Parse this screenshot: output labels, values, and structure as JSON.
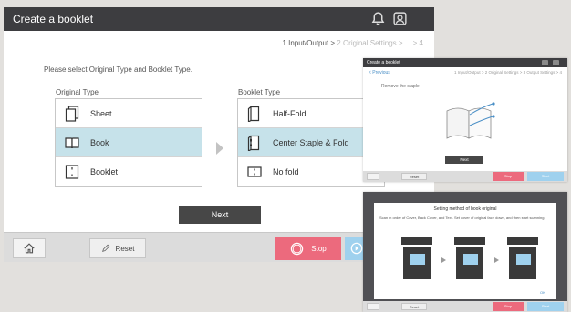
{
  "main": {
    "title": "Create a booklet",
    "steps": {
      "current": "1 Input/Output",
      "separator": " > ",
      "rest": "2 Original Settings > ... > 4"
    },
    "instruction": "Please select Original Type and Booklet Type.",
    "original_type": {
      "label": "Original Type",
      "options": [
        {
          "label": "Sheet",
          "icon": "sheet-icon",
          "selected": false
        },
        {
          "label": "Book",
          "icon": "book-icon",
          "selected": true
        },
        {
          "label": "Booklet",
          "icon": "booklet-icon",
          "selected": false
        }
      ]
    },
    "booklet_type": {
      "label": "Booklet Type",
      "options": [
        {
          "label": "Half-Fold",
          "icon": "half-fold-icon",
          "selected": false
        },
        {
          "label": "Center Staple & Fold",
          "icon": "center-staple-fold-icon",
          "selected": true
        },
        {
          "label": "No fold",
          "icon": "no-fold-icon",
          "selected": false
        }
      ]
    },
    "next_label": "Next",
    "bottom": {
      "reset_label": "Reset",
      "stop_label": "Stop"
    }
  },
  "thumb1": {
    "title": "Create a booklet",
    "previous_label": "< Previous",
    "steps": "1 Input/Output > 2 Original Settings > 3 Output Settings > 4",
    "instruction": "Remove the staple.",
    "next_label": "Next",
    "reset_label": "Reset",
    "stop_label": "Stop",
    "start_label": "Start"
  },
  "thumb2": {
    "dialog_title": "Setting method of book original",
    "dialog_text": "Scan in order of Cover, Back Cover, and Text. Set cover of original face down, and then start scanning.",
    "ok_label": "OK",
    "reset_label": "Reset",
    "stop_label": "Stop",
    "start_label": "Start"
  },
  "colors": {
    "title_bar": "#3d3d40",
    "selected_row": "#c6e2ea",
    "stop": "#ec6a7d",
    "start": "#9fd1ee",
    "next": "#474747",
    "link": "#4a8fc6"
  }
}
